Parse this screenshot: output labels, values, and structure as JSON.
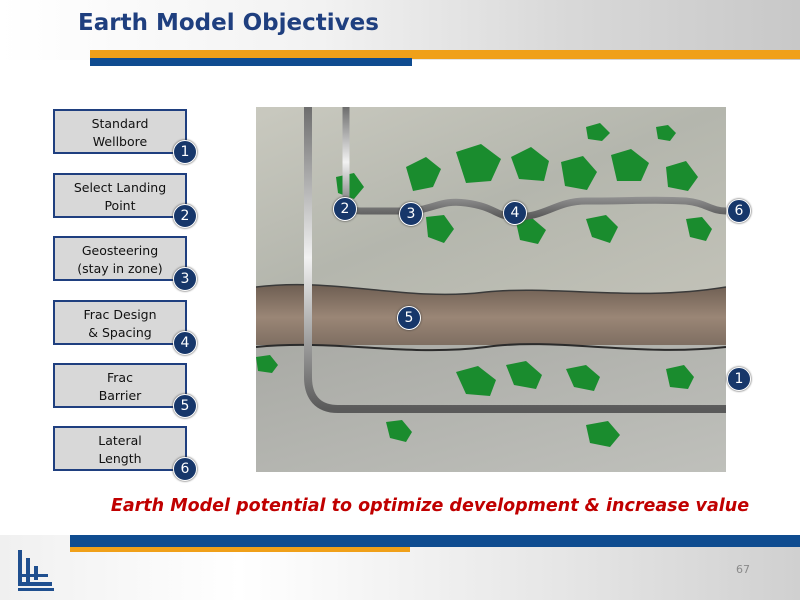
{
  "slide": {
    "title": "Earth Model Objectives",
    "caption": "Earth Model potential to optimize development & increase value",
    "page_number": "67"
  },
  "objectives": [
    {
      "line1": "Standard",
      "line2": "Wellbore",
      "num": "1"
    },
    {
      "line1": "Select Landing",
      "line2": "Point",
      "num": "2"
    },
    {
      "line1": "Geosteering",
      "line2": "(stay in zone)",
      "num": "3"
    },
    {
      "line1": "Frac Design",
      "line2": "& Spacing",
      "num": "4"
    },
    {
      "line1": "Frac",
      "line2": "Barrier",
      "num": "5"
    },
    {
      "line1": "Lateral",
      "line2": "Length",
      "num": "6"
    }
  ],
  "image_markers": [
    "1",
    "2",
    "3",
    "4",
    "5",
    "6"
  ],
  "colors": {
    "title": "#1f3f7f",
    "accent_orange": "#f0a019",
    "accent_blue": "#0f4c90",
    "caption": "#c00000",
    "marker": "#17376a"
  }
}
